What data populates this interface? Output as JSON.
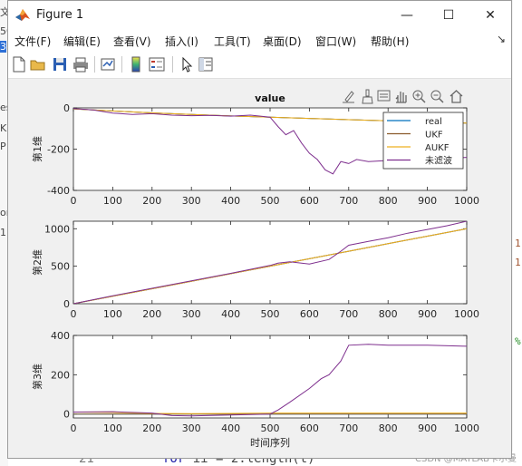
{
  "window": {
    "title": "Figure 1",
    "controls": {
      "minimize": "—",
      "maximize": "☐",
      "close": "✕"
    }
  },
  "menu": [
    {
      "label": "文件(F)"
    },
    {
      "label": "编辑(E)"
    },
    {
      "label": "查看(V)"
    },
    {
      "label": "插入(I)"
    },
    {
      "label": "工具(T)"
    },
    {
      "label": "桌面(D)"
    },
    {
      "label": "窗口(W)"
    },
    {
      "label": "帮助(H)"
    }
  ],
  "toolbar": {
    "icons": [
      "new-figure-icon",
      "open-file-icon",
      "save-icon",
      "print-icon",
      "link-plot-icon",
      "colorbar-icon",
      "legend-icon",
      "select-arrow-icon",
      "property-inspector-icon"
    ]
  },
  "axes_toolbar": {
    "icons": [
      "export-icon",
      "brush-icon",
      "data-tips-icon",
      "pan-icon",
      "zoom-in-icon",
      "zoom-out-icon",
      "home-icon"
    ]
  },
  "chart_data": [
    {
      "type": "line",
      "title": "value",
      "ylabel": "第1维",
      "xlabel": "",
      "xlim": [
        0,
        1000
      ],
      "ylim": [
        -400,
        0
      ],
      "xticks": [
        "0",
        "100",
        "200",
        "300",
        "400",
        "500",
        "600",
        "700",
        "800",
        "900",
        "1000"
      ],
      "yticks": [
        "0",
        "-200",
        "-400"
      ],
      "legend_position": "top-right",
      "series": [
        {
          "name": "real",
          "color": "#0072BD",
          "x": [
            0,
            100,
            200,
            300,
            400,
            500,
            600,
            700,
            800,
            900,
            1000
          ],
          "y": [
            -5,
            -15,
            -24,
            -32,
            -39,
            -45,
            -51,
            -57,
            -63,
            -69,
            -74
          ]
        },
        {
          "name": "UKF",
          "color": "#8B5A2B",
          "x": [
            0,
            100,
            200,
            300,
            400,
            500,
            600,
            700,
            800,
            900,
            1000
          ],
          "y": [
            -5,
            -15,
            -24,
            -32,
            -39,
            -45,
            -51,
            -57,
            -63,
            -69,
            -74
          ]
        },
        {
          "name": "AUKF",
          "color": "#EDB120",
          "x": [
            0,
            100,
            200,
            300,
            400,
            500,
            600,
            700,
            800,
            900,
            1000
          ],
          "y": [
            -5,
            -15,
            -24,
            -32,
            -39,
            -45,
            -51,
            -57,
            -63,
            -69,
            -74
          ]
        },
        {
          "name": "未滤波",
          "color": "#7E2F8E",
          "x": [
            0,
            50,
            100,
            150,
            200,
            250,
            300,
            350,
            400,
            450,
            500,
            520,
            540,
            560,
            580,
            600,
            620,
            640,
            660,
            680,
            700,
            720,
            750,
            800,
            850,
            900,
            950,
            1000
          ],
          "y": [
            -3,
            -10,
            -25,
            -32,
            -28,
            -35,
            -38,
            -36,
            -40,
            -35,
            -45,
            -90,
            -130,
            -110,
            -170,
            -220,
            -250,
            -300,
            -320,
            -260,
            -270,
            -250,
            -260,
            -255,
            -260,
            -250,
            -245,
            -240
          ]
        }
      ]
    },
    {
      "type": "line",
      "title": "",
      "ylabel": "第2维",
      "xlabel": "",
      "xlim": [
        0,
        1000
      ],
      "ylim": [
        0,
        1100
      ],
      "xticks": [
        "0",
        "100",
        "200",
        "300",
        "400",
        "500",
        "600",
        "700",
        "800",
        "900",
        "1000"
      ],
      "yticks": [
        "0",
        "500",
        "1000"
      ],
      "series": [
        {
          "name": "real",
          "color": "#0072BD",
          "x": [
            0,
            100,
            200,
            300,
            400,
            500,
            600,
            700,
            800,
            900,
            1000
          ],
          "y": [
            0,
            100,
            200,
            300,
            400,
            500,
            600,
            700,
            800,
            900,
            1000
          ]
        },
        {
          "name": "UKF",
          "color": "#8B5A2B",
          "x": [
            0,
            100,
            200,
            300,
            400,
            500,
            600,
            700,
            800,
            900,
            1000
          ],
          "y": [
            0,
            100,
            200,
            300,
            400,
            500,
            600,
            700,
            800,
            900,
            1000
          ]
        },
        {
          "name": "AUKF",
          "color": "#EDB120",
          "x": [
            0,
            100,
            200,
            300,
            400,
            500,
            600,
            700,
            800,
            900,
            1000
          ],
          "y": [
            0,
            100,
            200,
            300,
            400,
            500,
            600,
            700,
            800,
            900,
            1000
          ]
        },
        {
          "name": "未滤波",
          "color": "#7E2F8E",
          "x": [
            0,
            100,
            200,
            300,
            400,
            500,
            520,
            550,
            600,
            650,
            680,
            700,
            750,
            800,
            850,
            900,
            950,
            1000
          ],
          "y": [
            0,
            105,
            205,
            305,
            405,
            510,
            540,
            560,
            530,
            590,
            700,
            780,
            830,
            880,
            940,
            990,
            1040,
            1100
          ]
        }
      ]
    },
    {
      "type": "line",
      "title": "",
      "ylabel": "第3维",
      "xlabel": "时间序列",
      "xlim": [
        0,
        1000
      ],
      "ylim": [
        -20,
        400
      ],
      "xticks": [
        "0",
        "100",
        "200",
        "300",
        "400",
        "500",
        "600",
        "700",
        "800",
        "900",
        "1000"
      ],
      "yticks": [
        "0",
        "200",
        "400"
      ],
      "series": [
        {
          "name": "real",
          "color": "#0072BD",
          "x": [
            0,
            500,
            1000
          ],
          "y": [
            0,
            0,
            0
          ]
        },
        {
          "name": "UKF",
          "color": "#8B5A2B",
          "x": [
            0,
            500,
            1000
          ],
          "y": [
            0,
            0,
            0
          ]
        },
        {
          "name": "AUKF",
          "color": "#EDB120",
          "x": [
            0,
            100,
            200,
            300,
            400,
            500,
            600,
            700,
            800,
            900,
            1000
          ],
          "y": [
            10,
            8,
            3,
            2,
            3,
            5,
            5,
            5,
            5,
            5,
            5
          ]
        },
        {
          "name": "未滤波",
          "color": "#7E2F8E",
          "x": [
            0,
            100,
            200,
            250,
            300,
            400,
            500,
            520,
            550,
            600,
            630,
            650,
            680,
            700,
            750,
            800,
            900,
            1000
          ],
          "y": [
            10,
            12,
            5,
            -8,
            -10,
            -5,
            0,
            20,
            60,
            130,
            180,
            200,
            270,
            350,
            355,
            350,
            350,
            345
          ]
        }
      ]
    }
  ],
  "background": {
    "left_fragments": [
      "文",
      "50",
      "3",
      "es",
      "K",
      "P",
      "or",
      "1"
    ],
    "right_fragments": [
      "1",
      "1",
      "%"
    ],
    "bottom_line_no": "21",
    "bottom_code_kw": "for",
    "bottom_code_rest": " ii = 2:length(t)",
    "watermark": "CSDN @MATLAB卡尔曼"
  }
}
